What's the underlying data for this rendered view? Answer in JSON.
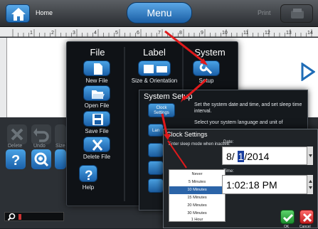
{
  "topbar": {
    "home_label": "Home",
    "menu_label": "Menu",
    "print_label": "Print"
  },
  "toolbar": {
    "delete_label": "Delete",
    "undo_label": "Undo",
    "size_label": "Size"
  },
  "menu": {
    "file_header": "File",
    "label_header": "Label",
    "system_header": "System",
    "new_file": "New File",
    "open_file": "Open File",
    "save_file": "Save File",
    "delete_file": "Delete File",
    "size_orientation": "Size & Orientation",
    "setup": "Setup",
    "help": "Help"
  },
  "system_setup": {
    "title": "System Setup",
    "clock_settings_btn": "Clock Settings",
    "clock_desc": "Set the system date and time, and set sleep time interval.",
    "language_btn": "Lan",
    "language_desc": "Select your system language and unit of"
  },
  "clock_settings": {
    "title": "Clock Settings",
    "sleep_label": "Enter sleep mode when inactive:",
    "sleep_options": [
      "Never",
      "5 Minutes",
      "10 Minutes",
      "15 Minutes",
      "20 Minutes",
      "30 Minutes",
      "1 Hour"
    ],
    "selected_option": "10 Minutes",
    "date_label": "Date:",
    "date_prefix": "8/ ",
    "date_selected": "1",
    "date_suffix": "/2014",
    "time_label": "Time:",
    "time_value": "1:02:18 PM",
    "ok_label": "OK",
    "cancel_label": "Cancel"
  },
  "ruler_numbers": [
    "1",
    "2",
    "3",
    "4",
    "5",
    "6",
    "7",
    "8",
    "9",
    "10",
    "11",
    "12",
    "13",
    "14"
  ],
  "colors": {
    "accent_blue": "#1f6cb6",
    "annotation_red": "#e0191b",
    "ok_green": "#1b8c2d",
    "cancel_red": "#c01d1d"
  }
}
